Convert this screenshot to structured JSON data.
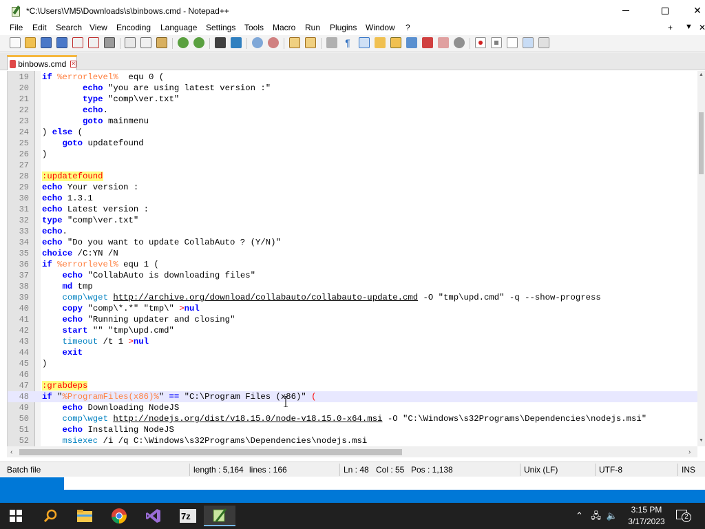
{
  "window": {
    "title": "*C:\\Users\\VM5\\Downloads\\s\\binbows.cmd - Notepad++"
  },
  "menu": {
    "items": [
      "File",
      "Edit",
      "Search",
      "View",
      "Encoding",
      "Language",
      "Settings",
      "Tools",
      "Macro",
      "Run",
      "Plugins",
      "Window",
      "?"
    ],
    "right": [
      "+",
      "▼",
      "✕"
    ]
  },
  "tab": {
    "label": "binbows.cmd"
  },
  "editor": {
    "current_line": 48,
    "lines": [
      {
        "n": "19",
        "segs": [
          [
            "kw",
            "if "
          ],
          [
            "var",
            "%errorlevel%"
          ],
          [
            "",
            "  equ 0 ("
          ]
        ]
      },
      {
        "n": "20",
        "segs": [
          [
            "",
            "        "
          ],
          [
            "kw",
            "echo"
          ],
          [
            "",
            " \"you are using latest version :\""
          ]
        ]
      },
      {
        "n": "21",
        "segs": [
          [
            "",
            "        "
          ],
          [
            "kw",
            "type"
          ],
          [
            "",
            " \"comp\\ver.txt\""
          ]
        ]
      },
      {
        "n": "22",
        "segs": [
          [
            "",
            "        "
          ],
          [
            "kw",
            "echo"
          ],
          [
            "",
            "."
          ]
        ]
      },
      {
        "n": "23",
        "segs": [
          [
            "",
            "        "
          ],
          [
            "kw",
            "goto"
          ],
          [
            "",
            " mainmenu"
          ]
        ]
      },
      {
        "n": "24",
        "segs": [
          [
            "",
            ") "
          ],
          [
            "kw",
            "else"
          ],
          [
            "",
            " ("
          ]
        ]
      },
      {
        "n": "25",
        "segs": [
          [
            "",
            "    "
          ],
          [
            "kw",
            "goto"
          ],
          [
            "",
            " updatefound"
          ]
        ]
      },
      {
        "n": "26",
        "segs": [
          [
            "",
            ")"
          ]
        ]
      },
      {
        "n": "27",
        "segs": [
          [
            "",
            ""
          ]
        ]
      },
      {
        "n": "28",
        "segs": [
          [
            "label",
            ":updatefound"
          ]
        ]
      },
      {
        "n": "29",
        "segs": [
          [
            "kw",
            "echo"
          ],
          [
            "",
            " Your version :"
          ]
        ]
      },
      {
        "n": "30",
        "segs": [
          [
            "kw",
            "echo"
          ],
          [
            "",
            " 1.3.1"
          ]
        ]
      },
      {
        "n": "31",
        "segs": [
          [
            "kw",
            "echo"
          ],
          [
            "",
            " Latest version :"
          ]
        ]
      },
      {
        "n": "32",
        "segs": [
          [
            "kw",
            "type"
          ],
          [
            "",
            " \"comp\\ver.txt\""
          ]
        ]
      },
      {
        "n": "33",
        "segs": [
          [
            "kw",
            "echo"
          ],
          [
            "",
            "."
          ]
        ]
      },
      {
        "n": "34",
        "segs": [
          [
            "kw",
            "echo"
          ],
          [
            "",
            " \"Do you want to update CollabAuto ? (Y/N)\""
          ]
        ]
      },
      {
        "n": "35",
        "segs": [
          [
            "kw",
            "choice"
          ],
          [
            "",
            " /C:YN /N"
          ]
        ]
      },
      {
        "n": "36",
        "segs": [
          [
            "kw",
            "if "
          ],
          [
            "var",
            "%errorlevel%"
          ],
          [
            "",
            " equ 1 ("
          ]
        ]
      },
      {
        "n": "37",
        "segs": [
          [
            "",
            "    "
          ],
          [
            "kw",
            "echo"
          ],
          [
            "",
            " \"CollabAuto is downloading files\""
          ]
        ]
      },
      {
        "n": "38",
        "segs": [
          [
            "",
            "    "
          ],
          [
            "kw",
            "md"
          ],
          [
            "",
            " tmp"
          ]
        ]
      },
      {
        "n": "39",
        "segs": [
          [
            "",
            "    "
          ],
          [
            "ext",
            "comp\\wget"
          ],
          [
            "",
            " "
          ],
          [
            "url",
            "http://archive.org/download/collabauto/collabauto-update.cmd"
          ],
          [
            "",
            " -O \"tmp\\upd.cmd\" -q --show-progress"
          ]
        ]
      },
      {
        "n": "40",
        "segs": [
          [
            "",
            "    "
          ],
          [
            "kw",
            "copy"
          ],
          [
            "",
            " \"comp\\*.*\" \"tmp\\\" "
          ],
          [
            "op",
            ">"
          ],
          [
            "kw",
            "nul"
          ]
        ]
      },
      {
        "n": "41",
        "segs": [
          [
            "",
            "    "
          ],
          [
            "kw",
            "echo"
          ],
          [
            "",
            " \"Running updater and closing\""
          ]
        ]
      },
      {
        "n": "42",
        "segs": [
          [
            "",
            "    "
          ],
          [
            "kw",
            "start"
          ],
          [
            "",
            " \"\" \"tmp\\upd.cmd\""
          ]
        ]
      },
      {
        "n": "43",
        "segs": [
          [
            "",
            "    "
          ],
          [
            "ext",
            "timeout"
          ],
          [
            "",
            " /t 1 "
          ],
          [
            "op",
            ">"
          ],
          [
            "kw",
            "nul"
          ]
        ]
      },
      {
        "n": "44",
        "segs": [
          [
            "",
            "    "
          ],
          [
            "kw",
            "exit"
          ]
        ]
      },
      {
        "n": "45",
        "segs": [
          [
            "",
            ")"
          ]
        ]
      },
      {
        "n": "46",
        "segs": [
          [
            "",
            ""
          ]
        ]
      },
      {
        "n": "47",
        "segs": [
          [
            "label",
            ":grabdeps"
          ]
        ]
      },
      {
        "n": "48",
        "segs": [
          [
            "kw",
            "if "
          ],
          [
            "",
            "\""
          ],
          [
            "var",
            "%ProgramFiles(x86)%"
          ],
          [
            "",
            "\" "
          ],
          [
            "kw",
            "=="
          ],
          [
            "",
            " \"C:\\Program Files (x86)\" "
          ],
          [
            "op",
            "("
          ]
        ]
      },
      {
        "n": "49",
        "segs": [
          [
            "",
            "    "
          ],
          [
            "kw",
            "echo"
          ],
          [
            "",
            " Downloading NodeJS"
          ]
        ]
      },
      {
        "n": "50",
        "segs": [
          [
            "",
            "    "
          ],
          [
            "ext",
            "comp\\wget"
          ],
          [
            "",
            " "
          ],
          [
            "url",
            "http://nodejs.org/dist/v18.15.0/node-v18.15.0-x64.msi"
          ],
          [
            "",
            " -O \"C:\\Windows\\s32Programs\\Dependencies\\nodejs.msi\""
          ]
        ]
      },
      {
        "n": "51",
        "segs": [
          [
            "",
            "    "
          ],
          [
            "kw",
            "echo"
          ],
          [
            "",
            " Installing NodeJS"
          ]
        ]
      },
      {
        "n": "52",
        "segs": [
          [
            "",
            "    "
          ],
          [
            "ext",
            "msiexec"
          ],
          [
            "",
            " /i /q C:\\Windows\\s32Programs\\Dependencies\\nodejs.msi"
          ]
        ]
      }
    ]
  },
  "status": {
    "lang": "Batch file",
    "length": "length : 5,164",
    "lines": "lines : 166",
    "ln": "Ln : 48",
    "col": "Col : 55",
    "pos": "Pos : 1,138",
    "eol": "Unix (LF)",
    "encoding": "UTF-8",
    "mode": "INS"
  },
  "taskbar": {
    "clock_time": "3:15 PM",
    "clock_date": "3/17/2023",
    "notification_count": "2",
    "apps": [
      "start",
      "search",
      "file-explorer",
      "chrome",
      "visual-studio",
      "7zip",
      "notepad-plus-plus"
    ]
  },
  "colors": {
    "keyword": "#0000ff",
    "variable": "#ff8040",
    "label_bg": "#ffff80",
    "current_line": "#e8e8ff",
    "accent": "#0078d7"
  }
}
